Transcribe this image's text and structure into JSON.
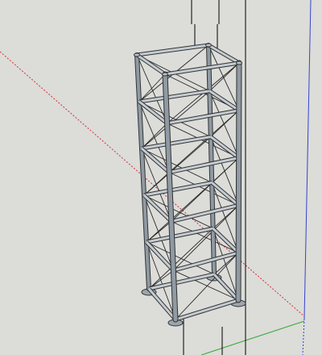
{
  "viewport": {
    "background": "#dcdcd9",
    "axis_colors": {
      "red": "#cc3333",
      "green": "#33aa33",
      "blue": "#3344cc"
    },
    "model": {
      "name": "scaffold-tower",
      "levels": 6,
      "post_color": "#8f9aa3",
      "ledger_color": "#c4ccd2",
      "brace_color": "#2a2a2a"
    }
  }
}
